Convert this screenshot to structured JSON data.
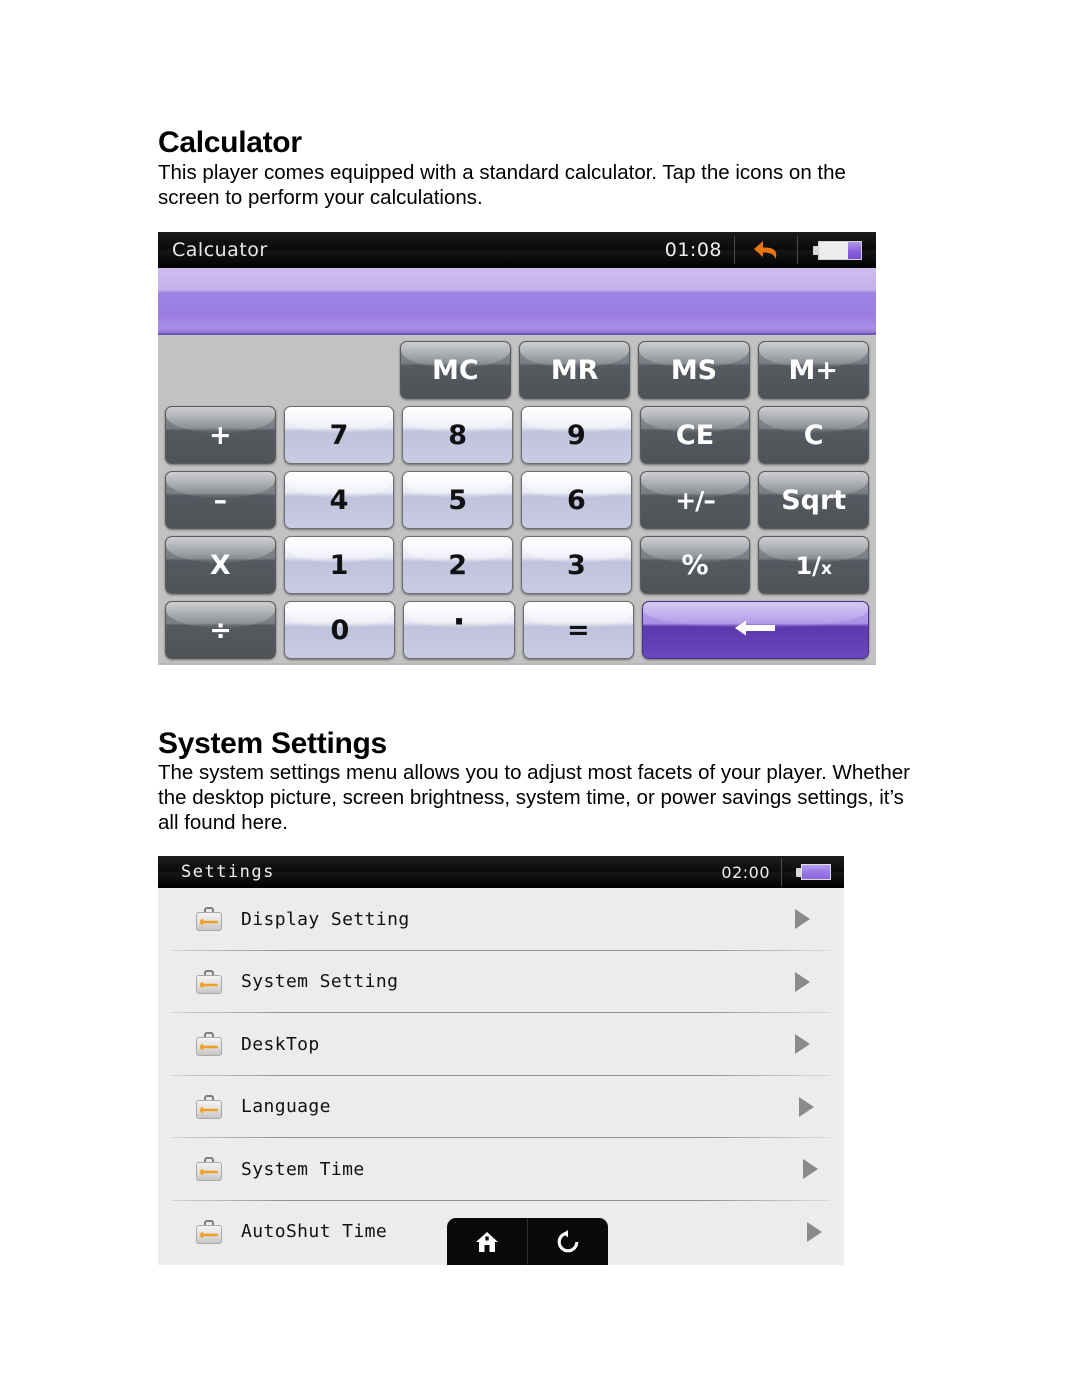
{
  "document": {
    "sections": [
      {
        "heading": "Calculator",
        "body": "This player comes equipped with a standard calculator. Tap the icons on the screen to perform your calculations."
      },
      {
        "heading": "System Settings",
        "body": "The system settings menu allows you to adjust most facets of your player. Whether the desktop picture, screen brightness, system time, or power savings settings, it’s all found here."
      }
    ]
  },
  "calculator_screen": {
    "titlebar": {
      "title": "Calcuator",
      "clock": "01:08",
      "back_icon": "back-arrow-icon",
      "back_icon_color": "#e8730f",
      "battery_icon": "battery-icon",
      "battery_level_percent": 30,
      "battery_fill_color": "#8a64dc"
    },
    "display": {
      "value": "",
      "background_top_color": "#cdbdee",
      "background_bottom_color": "#9a7ce2"
    },
    "keypad": {
      "rows": [
        [
          {
            "label": "",
            "type": "empty",
            "name": "key-empty-1"
          },
          {
            "label": "",
            "type": "empty",
            "name": "key-empty-2"
          },
          {
            "label": "MC",
            "type": "fn",
            "name": "key-memory-clear"
          },
          {
            "label": "MR",
            "type": "fn",
            "name": "key-memory-recall"
          },
          {
            "label": "MS",
            "type": "fn",
            "name": "key-memory-store"
          },
          {
            "label": "M+",
            "type": "fn",
            "name": "key-memory-add"
          }
        ],
        [
          {
            "label": "+",
            "type": "fn",
            "name": "key-plus"
          },
          {
            "label": "7",
            "type": "num",
            "name": "key-7"
          },
          {
            "label": "8",
            "type": "num",
            "name": "key-8"
          },
          {
            "label": "9",
            "type": "num",
            "name": "key-9"
          },
          {
            "label": "CE",
            "type": "fn",
            "name": "key-clear-entry"
          },
          {
            "label": "C",
            "type": "fn",
            "name": "key-clear"
          }
        ],
        [
          {
            "label": "–",
            "type": "fn",
            "name": "key-minus"
          },
          {
            "label": "4",
            "type": "num",
            "name": "key-4"
          },
          {
            "label": "5",
            "type": "num",
            "name": "key-5"
          },
          {
            "label": "6",
            "type": "num",
            "name": "key-6"
          },
          {
            "label": "+/–",
            "type": "fn",
            "name": "key-sign-toggle",
            "glyph": "plusminus"
          },
          {
            "label": "Sqrt",
            "type": "fn",
            "name": "key-square-root"
          }
        ],
        [
          {
            "label": "X",
            "type": "fn",
            "name": "key-multiply"
          },
          {
            "label": "1",
            "type": "num",
            "name": "key-1"
          },
          {
            "label": "2",
            "type": "num",
            "name": "key-2"
          },
          {
            "label": "3",
            "type": "num",
            "name": "key-3"
          },
          {
            "label": "%",
            "type": "fn",
            "name": "key-percent"
          },
          {
            "label": "1/x",
            "type": "fn",
            "name": "key-reciprocal",
            "glyph": "reciprocal"
          }
        ],
        [
          {
            "label": "÷",
            "type": "fn",
            "name": "key-divide"
          },
          {
            "label": "0",
            "type": "num",
            "name": "key-0"
          },
          {
            "label": ".",
            "type": "num",
            "name": "key-decimal",
            "glyph": "dot"
          },
          {
            "label": "=",
            "type": "num",
            "name": "key-equals"
          },
          {
            "label": "",
            "type": "accent",
            "name": "key-backspace",
            "glyph": "backspace",
            "span": 2
          }
        ]
      ]
    }
  },
  "settings_screen": {
    "titlebar": {
      "title": "Settings",
      "clock": "02:00",
      "battery_icon": "battery-icon",
      "battery_level_percent": 100,
      "battery_fill_color": "#9a78e8"
    },
    "items": [
      {
        "label": "Display Setting",
        "icon": "toolbox-wrench-icon",
        "arrow": "chevron-right-icon"
      },
      {
        "label": "System Setting",
        "icon": "toolbox-wrench-icon",
        "arrow": "chevron-right-icon"
      },
      {
        "label": "DeskTop",
        "icon": "toolbox-wrench-icon",
        "arrow": "chevron-right-icon"
      },
      {
        "label": "Language",
        "icon": "toolbox-wrench-icon",
        "arrow": "chevron-right-icon"
      },
      {
        "label": "System Time",
        "icon": "toolbox-wrench-icon",
        "arrow": "chevron-right-icon"
      },
      {
        "label": "AutoShut Time",
        "icon": "toolbox-wrench-icon",
        "arrow": "chevron-right-icon"
      }
    ],
    "navbar": {
      "buttons": [
        {
          "name": "home-button",
          "icon": "home-icon"
        },
        {
          "name": "return-button",
          "icon": "rotate-counterclockwise-icon"
        }
      ]
    }
  }
}
